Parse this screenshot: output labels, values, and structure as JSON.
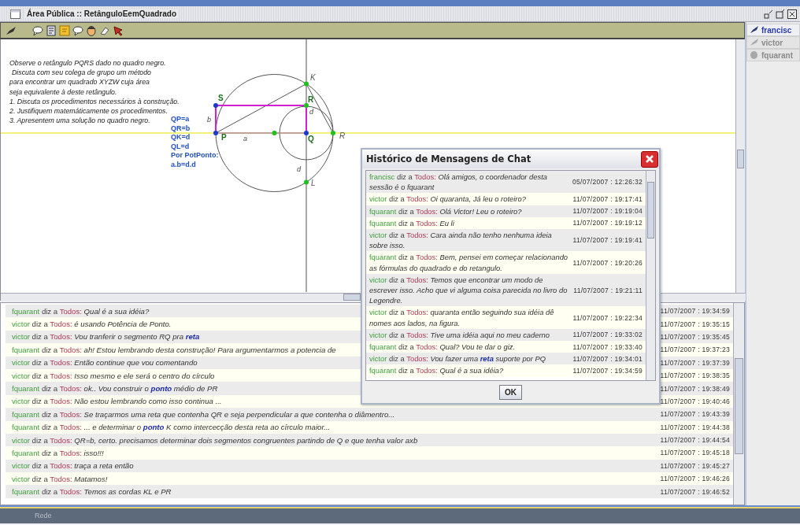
{
  "window": {
    "title": "Área Pública :: RetânguloEemQuadrado"
  },
  "board": {
    "instructions": [
      "Observe o retângulo PQRS dado no quadro negro.",
      "Discuta com seu colega de grupo um método",
      "para encontrar um quadrado XYZW cuja área",
      "seja equivalente à deste retângulo.",
      "1. Discuta os procedimentos necessários à construção.",
      "2. Justifiquem matemáticamente os procedimentos.",
      "3. Apresentem uma solução no quadro negro."
    ],
    "formulas": [
      "QP=a",
      "QR=b",
      "QK=d",
      "QL=d",
      "Por PotPonto:",
      "a.b=d.d"
    ],
    "labels": [
      {
        "text": "K",
        "kind": "point"
      },
      {
        "text": "S",
        "kind": "vertex"
      },
      {
        "text": "R",
        "kind": "vertex"
      },
      {
        "text": "b",
        "kind": "segment"
      },
      {
        "text": "d",
        "kind": "segment"
      },
      {
        "text": "P",
        "kind": "vertex"
      },
      {
        "text": "a",
        "kind": "segment"
      },
      {
        "text": "Q",
        "kind": "vertex"
      },
      {
        "text": "R",
        "kind": "point"
      },
      {
        "text": "d",
        "kind": "segment"
      },
      {
        "text": "L",
        "kind": "point"
      }
    ]
  },
  "chat_log": [
    {
      "sender": "fquarant",
      "verb": "diz a",
      "recipient": "Todos:",
      "text": "Qual é a sua idéia?",
      "time": "11/07/2007 : 19:34:59"
    },
    {
      "sender": "victor",
      "verb": "diz a",
      "recipient": "Todos:",
      "text": "é usando Potência de Ponto.",
      "time": "11/07/2007 : 19:35:15"
    },
    {
      "sender": "victor",
      "verb": "diz a",
      "recipient": "Todos:",
      "text": "Vou tranferir o segmento RQ pra **reta**",
      "time": "11/07/2007 : 19:35:45"
    },
    {
      "sender": "fquarant",
      "verb": "diz a",
      "recipient": "Todos:",
      "text": "ah! Estou lembrando desta construção! Para argumentarmos a potencia de",
      "time": "11/07/2007 : 19:37:23"
    },
    {
      "sender": "victor",
      "verb": "diz a",
      "recipient": "Todos:",
      "text": "Então continue que vou comentando",
      "time": "11/07/2007 : 19:37:39"
    },
    {
      "sender": "victor",
      "verb": "diz a",
      "recipient": "Todos:",
      "text": "Isso mesmo e ele será o centro do círculo",
      "time": "11/07/2007 : 19:38:35"
    },
    {
      "sender": "fquarant",
      "verb": "diz a",
      "recipient": "Todos:",
      "text": "ok.. Vou construir o **ponto** médio de PR",
      "time": "11/07/2007 : 19:38:49"
    },
    {
      "sender": "victor",
      "verb": "diz a",
      "recipient": "Todos:",
      "text": "Não estou lembrando como isso continua ...",
      "time": "11/07/2007 : 19:40:46"
    },
    {
      "sender": "fquarant",
      "verb": "diz a",
      "recipient": "Todos:",
      "text": "Se traçarmos uma reta que contenha QR e seja perpendicular a que contenha o diâmentro...",
      "time": "11/07/2007 : 19:43:39"
    },
    {
      "sender": "fquarant",
      "verb": "diz a",
      "recipient": "Todos:",
      "text": "... e determinar o **ponto** K como intercecção desta reta ao círculo maior...",
      "time": "11/07/2007 : 19:44:38"
    },
    {
      "sender": "victor",
      "verb": "diz a",
      "recipient": "Todos:",
      "text": "QR=b, certo. precisamos determinar dois segmentos congruentes partindo de Q e que tenha valor axb",
      "time": "11/07/2007 : 19:44:54"
    },
    {
      "sender": "fquarant",
      "verb": "diz a",
      "recipient": "Todos:",
      "text": "isso!!!",
      "time": "11/07/2007 : 19:45:18"
    },
    {
      "sender": "victor",
      "verb": "diz a",
      "recipient": "Todos:",
      "text": "traça a reta então",
      "time": "11/07/2007 : 19:45:27"
    },
    {
      "sender": "victor",
      "verb": "diz a",
      "recipient": "Todos:",
      "text": "Matamos!",
      "time": "11/07/2007 : 19:46:26"
    },
    {
      "sender": "fquarant",
      "verb": "diz a",
      "recipient": "Todos:",
      "text": "Temos as cordas KL e PR",
      "time": "11/07/2007 : 19:46:52"
    }
  ],
  "users": [
    {
      "name": "francisc",
      "kind": "pen",
      "active": true
    },
    {
      "name": "victor",
      "kind": "pen",
      "active": false
    },
    {
      "name": "fquarant",
      "kind": "face",
      "active": false
    }
  ],
  "history_dialog": {
    "title": "Histórico de Mensagens de Chat",
    "messages": [
      {
        "sender": "francisc",
        "verb": "diz a",
        "recipient": "Todos:",
        "text": "Olá amigos, o coordenador desta sessão é o fquarant",
        "time": "05/07/2007 : 12:26:32"
      },
      {
        "sender": "victor",
        "verb": "diz a",
        "recipient": "Todos:",
        "text": "Oi quaranta, Já leu o roteiro?",
        "time": "11/07/2007 : 19:17:41"
      },
      {
        "sender": "fquarant",
        "verb": "diz a",
        "recipient": "Todos:",
        "text": "Olá Victor! Leu o roteiro?",
        "time": "11/07/2007 : 19:19:04"
      },
      {
        "sender": "fquarant",
        "verb": "diz a",
        "recipient": "Todos:",
        "text": "Eu li",
        "time": "11/07/2007 : 19:19:12"
      },
      {
        "sender": "victor",
        "verb": "diz a",
        "recipient": "Todos:",
        "text": "Cara ainda não tenho nenhuma ideia sobre isso.",
        "time": "11/07/2007 : 19:19:41"
      },
      {
        "sender": "fquarant",
        "verb": "diz a",
        "recipient": "Todos:",
        "text": "Bem, pensei em começar relacionando as fórmulas do quadrado e do retangulo.",
        "time": "11/07/2007 : 19:20:26"
      },
      {
        "sender": "victor",
        "verb": "diz a",
        "recipient": "Todos:",
        "text": "Temos que encontrar um modo de escrever isso. Acho que vi alguma coisa parecida no livro do Legendre.",
        "time": "11/07/2007 : 19:21:11"
      },
      {
        "sender": "victor",
        "verb": "diz a",
        "recipient": "Todos:",
        "text": "quaranta então seguindo sua idéia dê nomes aos lados, na figura.",
        "time": "11/07/2007 : 19:22:34"
      },
      {
        "sender": "victor",
        "verb": "diz a",
        "recipient": "Todos:",
        "text": "Tive uma idéia aqui no meu caderno",
        "time": "11/07/2007 : 19:33:02"
      },
      {
        "sender": "fquarant",
        "verb": "diz a",
        "recipient": "Todos:",
        "text": "Qual? Vou te dar o giz.",
        "time": "11/07/2007 : 19:33:40"
      },
      {
        "sender": "victor",
        "verb": "diz a",
        "recipient": "Todos:",
        "text": "Vou fazer uma **reta** suporte por PQ",
        "time": "11/07/2007 : 19:34:01"
      },
      {
        "sender": "fquarant",
        "verb": "diz a",
        "recipient": "Todos:",
        "text": "Qual é a sua idéia?",
        "time": "11/07/2007 : 19:34:59"
      }
    ],
    "ok_button": "OK"
  },
  "status_bar": {
    "text": "Rede"
  }
}
